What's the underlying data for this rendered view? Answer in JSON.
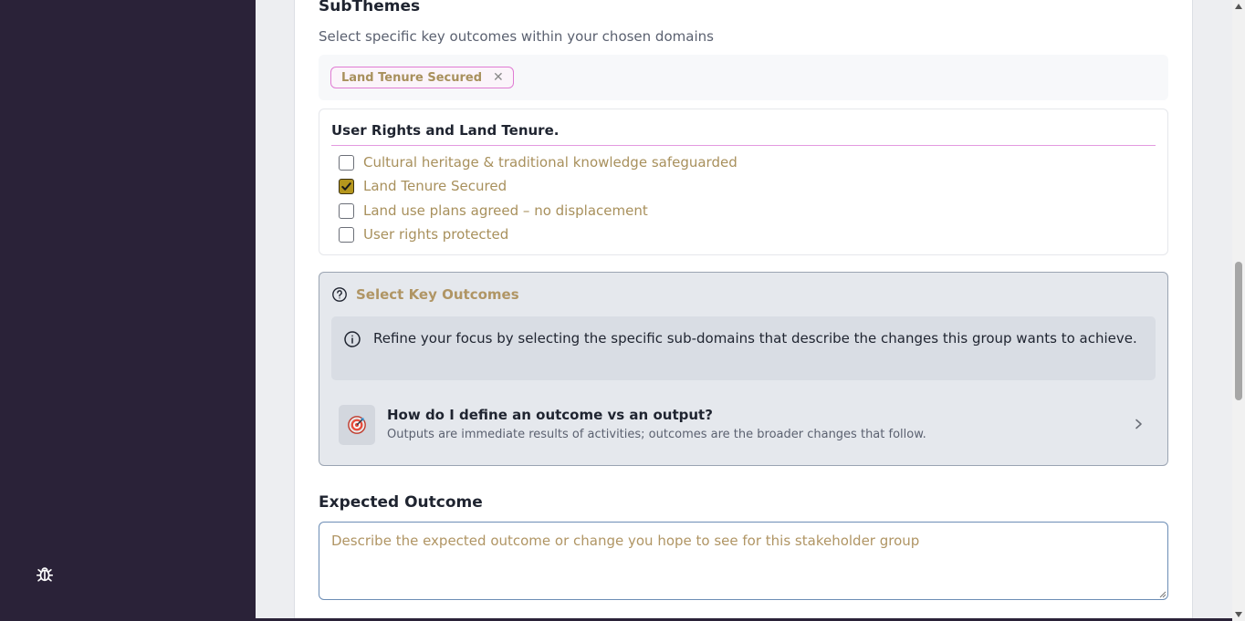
{
  "subthemes": {
    "title": "SubThemes",
    "subtitle": "Select specific key outcomes within your chosen domains",
    "selected_chips": [
      {
        "label": "Land Tenure Secured",
        "remove_icon": "close-icon"
      }
    ]
  },
  "group": {
    "title": "User Rights and Land Tenure.",
    "options": [
      {
        "label": "Cultural heritage & traditional knowledge safeguarded",
        "checked": false
      },
      {
        "label": "Land Tenure Secured",
        "checked": true
      },
      {
        "label": "Land use plans agreed – no displacement",
        "checked": false
      },
      {
        "label": "User rights protected",
        "checked": false
      }
    ]
  },
  "key_outcomes": {
    "title": "Select Key Outcomes",
    "icon": "help-circle-icon",
    "info_icon": "info-icon",
    "info_text": "Refine your focus by selecting the specific sub-domains that describe the changes this group wants to achieve.",
    "howto": {
      "icon": "target-icon",
      "title": "How do I define an outcome vs an output?",
      "description": "Outputs are immediate results of activities; outcomes are the broader changes that follow."
    }
  },
  "expected_outcome": {
    "label": "Expected Outcome",
    "placeholder": "Describe the expected outcome or change you hope to see for this stakeholder group",
    "value": ""
  },
  "sidebar": {
    "debug_icon": "bug-icon"
  },
  "colors": {
    "sidebar_bg": "#2a2238",
    "accent_pink": "#e07bd3",
    "muted_gold": "#a8905c",
    "checkbox_checked": "#b5961d"
  }
}
